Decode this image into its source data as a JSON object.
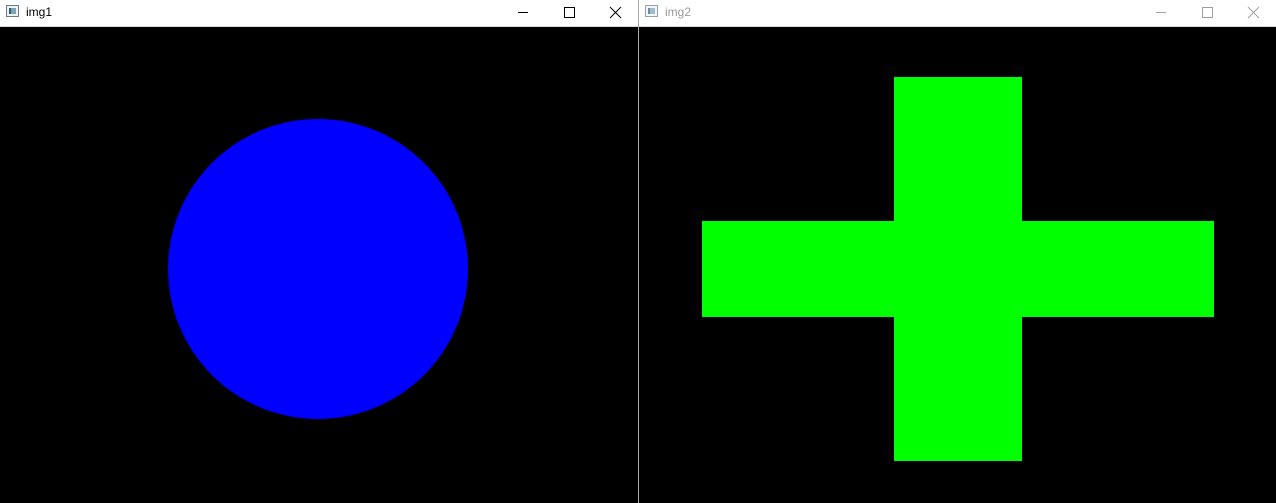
{
  "windows": [
    {
      "title": "img1",
      "state": "active",
      "content": {
        "shape": "circle",
        "fill_color": "#0000ff",
        "background_color": "#000000"
      }
    },
    {
      "title": "img2",
      "state": "inactive",
      "content": {
        "shape": "cross",
        "fill_color": "#00ff00",
        "background_color": "#000000"
      }
    }
  ],
  "controls": {
    "minimize_icon": "minimize-icon",
    "maximize_icon": "maximize-icon",
    "close_icon": "close-icon"
  },
  "colors": {
    "active_title_text": "#000000",
    "inactive_title_text": "#9a9a9a",
    "titlebar_background": "#ffffff"
  }
}
